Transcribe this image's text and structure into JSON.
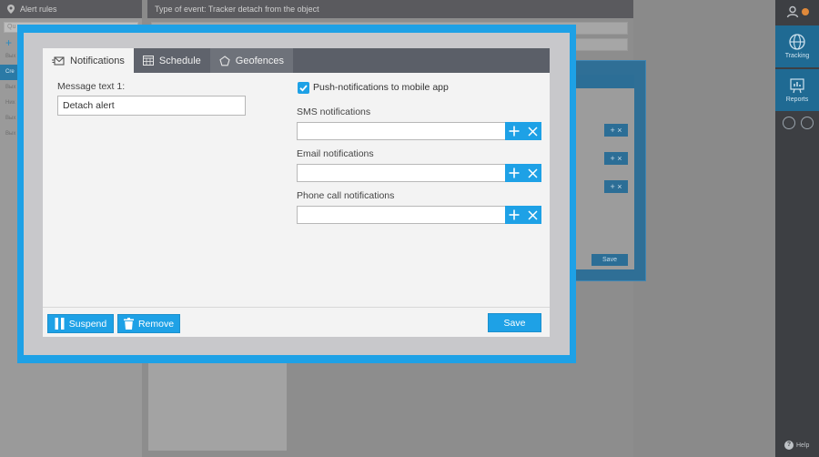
{
  "background": {
    "left_panel": {
      "title": "Alert rules",
      "search_placeholder": "Qu",
      "add_symbol": "+",
      "rows": [
        "Вых",
        "Cre",
        "Вых",
        "Них",
        "Вых",
        "Вых"
      ]
    },
    "main_panel": {
      "title": "Type of event: Tracker detach from the object"
    },
    "right_sidebar": {
      "items": [
        {
          "label": "Tracking",
          "icon": "globe-icon"
        },
        {
          "label": "Reports",
          "icon": "reports-icon"
        }
      ],
      "help_label": "Help"
    },
    "second_dialog": {
      "save_label": "Save"
    }
  },
  "dialog": {
    "tabs": [
      {
        "label": "Notifications",
        "icon": "envelope-icon",
        "active": true
      },
      {
        "label": "Schedule",
        "icon": "calendar-icon",
        "active": false
      },
      {
        "label": "Geofences",
        "icon": "pentagon-icon",
        "active": false
      }
    ],
    "message_label": "Message text 1:",
    "message_value": "Detach alert",
    "push": {
      "label": "Push-notifications to mobile app",
      "checked": true
    },
    "fields": [
      {
        "label": "SMS notifications",
        "value": ""
      },
      {
        "label": "Email notifications",
        "value": ""
      },
      {
        "label": "Phone call notifications",
        "value": ""
      }
    ],
    "buttons": {
      "suspend": "Suspend",
      "remove": "Remove",
      "save": "Save"
    }
  },
  "colors": {
    "accent": "#1ea1e6",
    "tab_bar": "#5b5f68",
    "card": "#f3f3f3"
  }
}
